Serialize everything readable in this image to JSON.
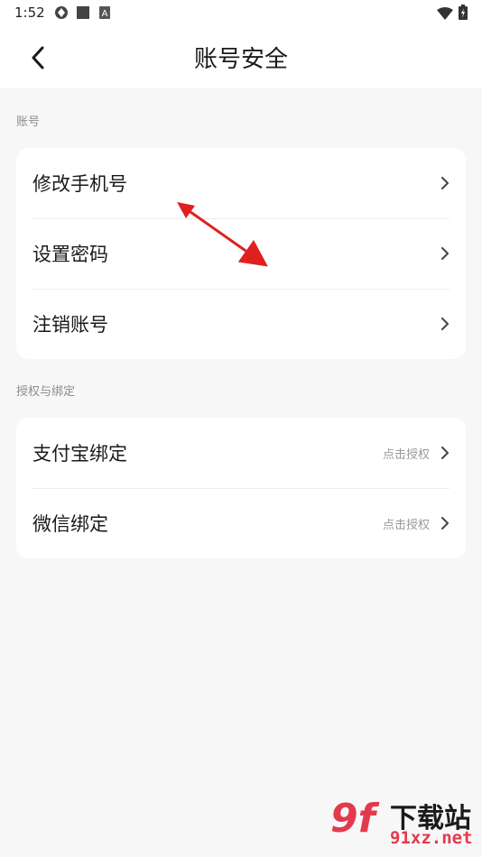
{
  "status_bar": {
    "time": "1:52",
    "icons_left": [
      "vpn-icon",
      "square-icon",
      "a-icon"
    ],
    "icons_right": [
      "wifi-icon",
      "battery-icon"
    ]
  },
  "header": {
    "title": "账号安全",
    "back_icon": "chevron-left-icon"
  },
  "sections": [
    {
      "label": "账号",
      "items": [
        {
          "label": "修改手机号",
          "hint": ""
        },
        {
          "label": "设置密码",
          "hint": ""
        },
        {
          "label": "注销账号",
          "hint": ""
        }
      ]
    },
    {
      "label": "授权与绑定",
      "items": [
        {
          "label": "支付宝绑定",
          "hint": "点击授权"
        },
        {
          "label": "微信绑定",
          "hint": "点击授权"
        }
      ]
    }
  ],
  "annotation": {
    "color": "#e02020"
  },
  "watermark": {
    "logo": "9f",
    "title": "下载站",
    "url": "91xz.net"
  },
  "colors": {
    "background": "#f7f7f7",
    "card": "#ffffff",
    "text": "#1a1a1a",
    "secondary_text": "#8c8c8c",
    "brand": "#e23a4c"
  }
}
